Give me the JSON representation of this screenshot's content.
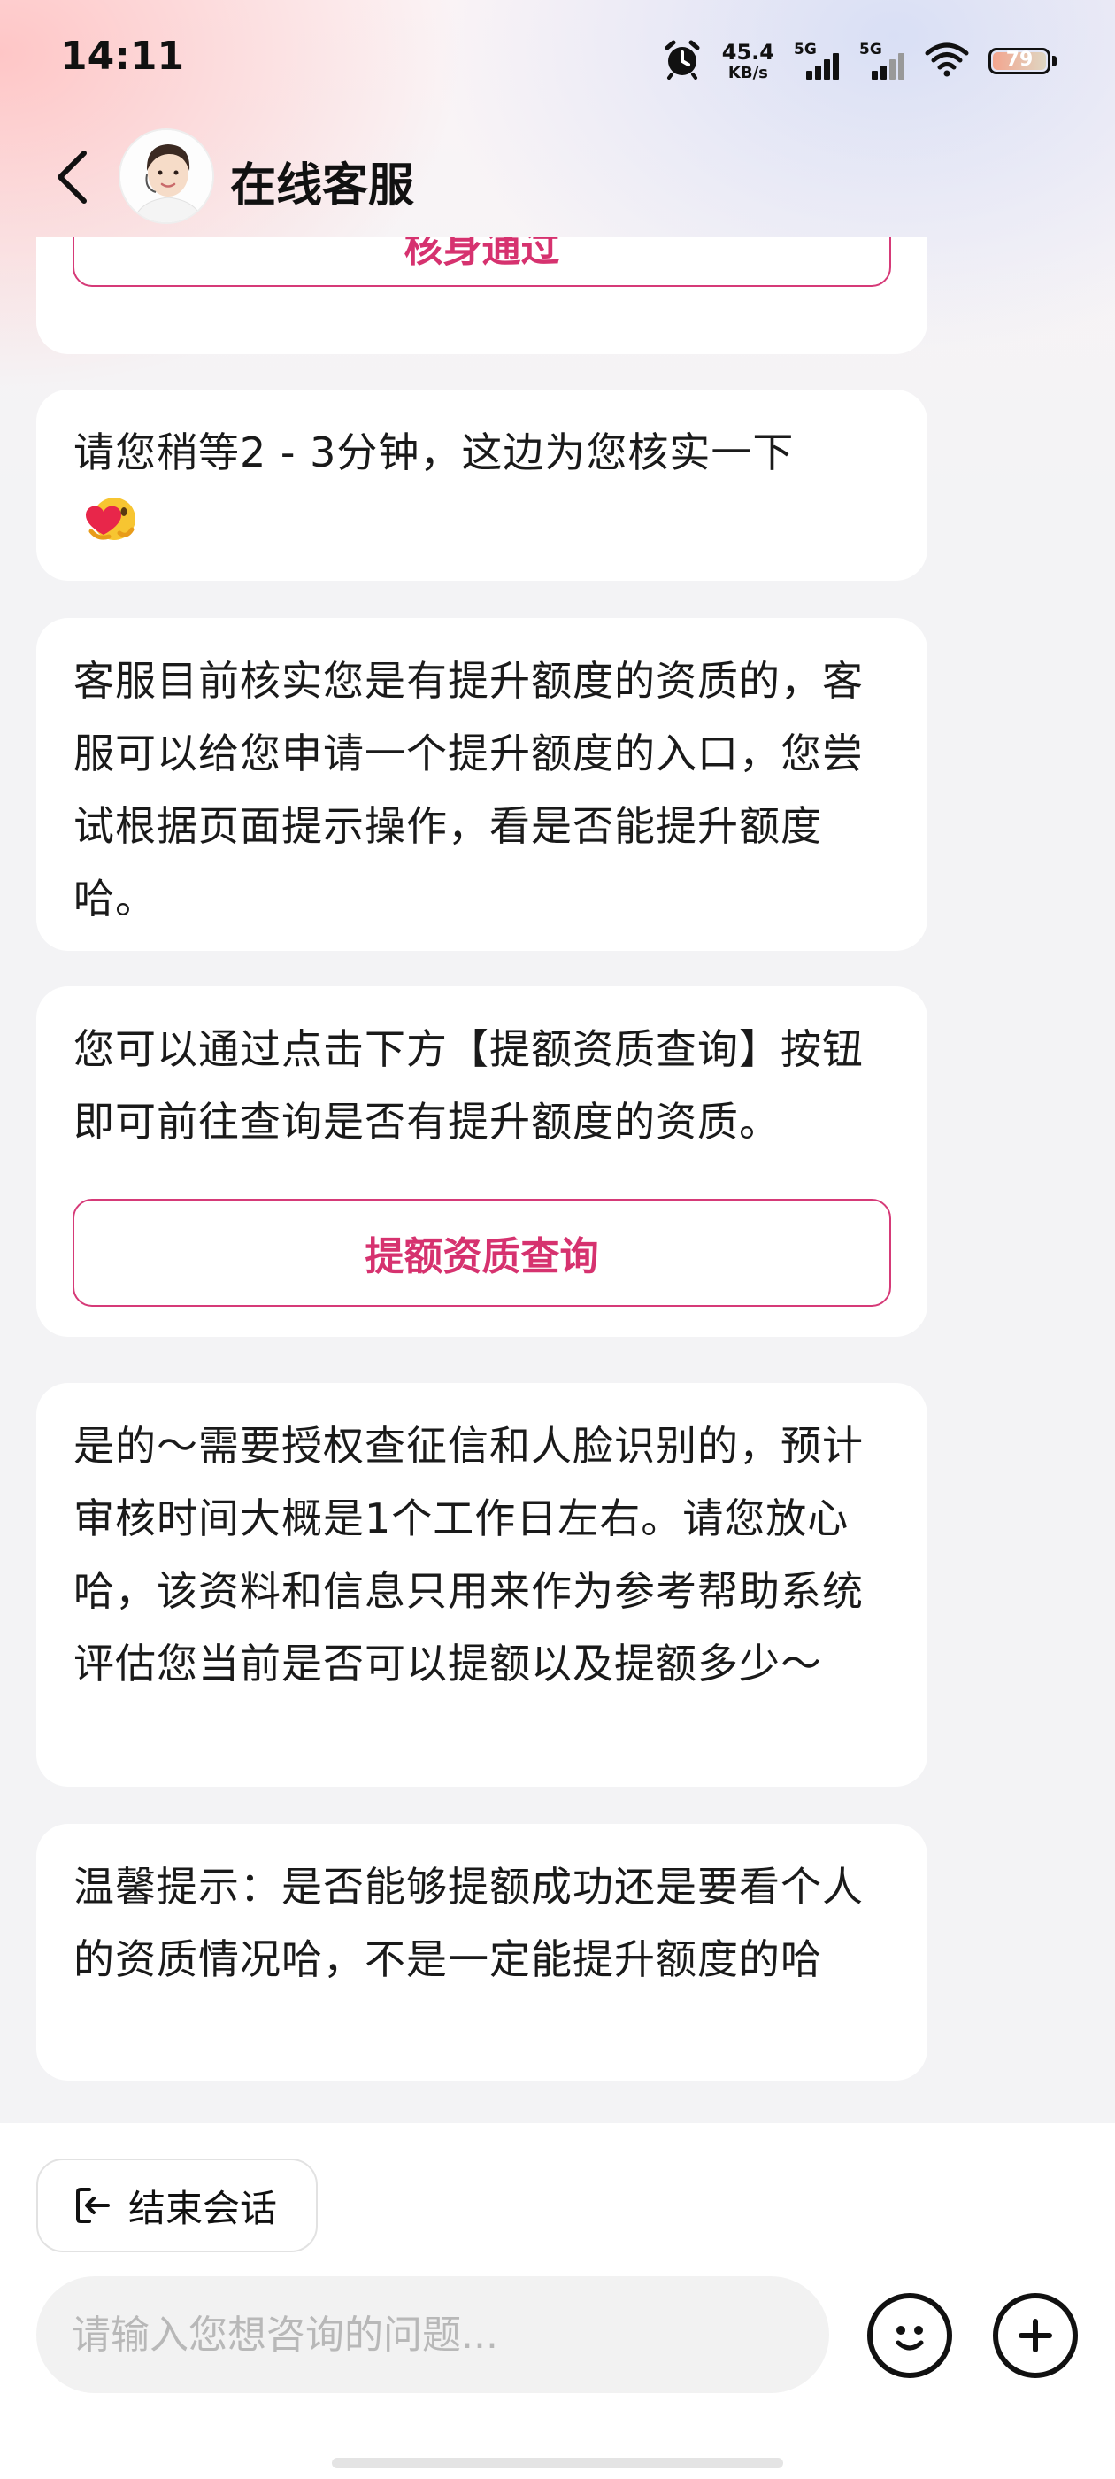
{
  "status_bar": {
    "time": "14:11",
    "net_speed_value": "45.4",
    "net_speed_unit": "KB/s",
    "signal1_label": "5G",
    "signal2_label": "5G",
    "battery_level": "79"
  },
  "header": {
    "title": "在线客服",
    "back_icon": "chevron-left-icon",
    "avatar": "agent-avatar"
  },
  "messages": [
    {
      "button_label": "核身通过"
    },
    {
      "text": "请您稍等2 - 3分钟，这边为您核实一下",
      "emoji": "heart-hug-emoji"
    },
    {
      "text": "客服目前核实您是有提升额度的资质的，客服可以给您申请一个提升额度的入口，您尝试根据页面提示操作，看是否能提升额度哈。"
    },
    {
      "text": "您可以通过点击下方【提额资质查询】按钮即可前往查询是否有提升额度的资质。",
      "button_label": "提额资质查询"
    },
    {
      "text": "是的～需要授权查征信和人脸识别的，预计审核时间大概是1个工作日左右。请您放心哈，该资料和信息只用来作为参考帮助系统评估您当前是否可以提额以及提额多少～"
    },
    {
      "text": "温馨提示：是否能够提额成功还是要看个人的资质情况哈，不是一定能提升额度的哈"
    }
  ],
  "bottom": {
    "end_chat_label": "结束会话",
    "input_placeholder": "请输入您想咨询的问题...",
    "emoji_button_icon": "smiley-icon",
    "plus_button_icon": "plus-icon"
  },
  "colors": {
    "accent": "#d6326f",
    "background": "#f3f3f5",
    "bubble": "#ffffff"
  }
}
